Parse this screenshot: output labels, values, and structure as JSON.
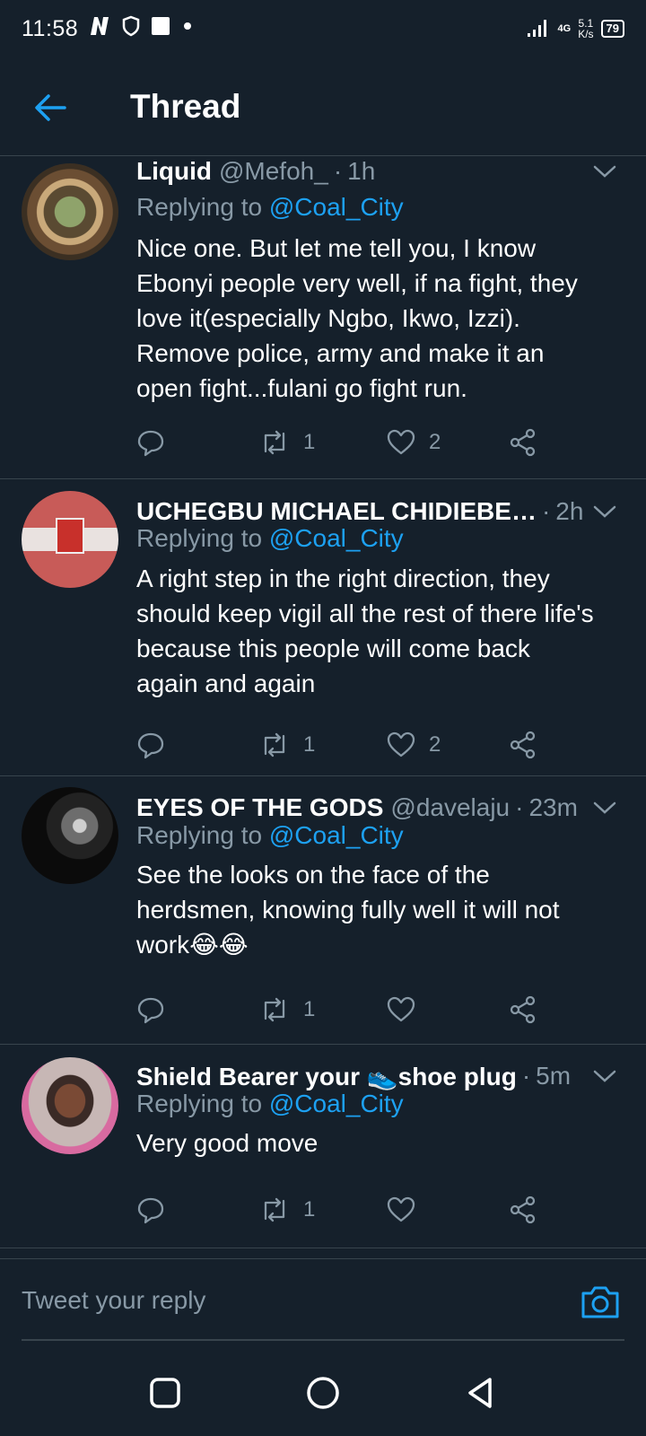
{
  "status_bar": {
    "time": "11:58",
    "network": "4G",
    "speed_value": "5.1",
    "speed_unit": "K/s",
    "battery": "79"
  },
  "header": {
    "title": "Thread",
    "back_icon": "arrow-left-icon"
  },
  "tweets": [
    {
      "name": "Liquid",
      "handle": "@Mefoh_",
      "time": "1h",
      "replying_prefix": "Replying to",
      "replying_to": "@Coal_City",
      "text_lines": [
        "Nice one. But let me tell you, I know",
        "Ebonyi people very well, if na fight, they",
        "love it(especially Ngbo, Ikwo, Izzi).",
        "Remove police, army and make it an",
        "open fight...fulani go fight run."
      ],
      "retweets": "1",
      "likes": "2"
    },
    {
      "name": "UCHEGBU MICHAEL CHIDIEBE…",
      "handle": "",
      "time": "2h",
      "replying_prefix": "Replying to",
      "replying_to": "@Coal_City",
      "text_lines": [
        "A right step in the right direction, they",
        "should keep vigil all the rest of there life's",
        "because this people will come back",
        "again and again"
      ],
      "retweets": "1",
      "likes": "2"
    },
    {
      "name": "EYES OF THE GODS",
      "handle": "@davelaju",
      "time": "23m",
      "replying_prefix": "Replying to",
      "replying_to": "@Coal_City",
      "text_lines": [
        "See the looks on the face of the",
        "herdsmen, knowing fully well it will not",
        "work😂😂"
      ],
      "retweets": "1",
      "likes": ""
    },
    {
      "name": "Shield Bearer your 👟shoe plug",
      "handle": "",
      "time": "5m",
      "replying_prefix": "Replying to",
      "replying_to": "@Coal_City",
      "text_lines": [
        "Very good move"
      ],
      "retweets": "1",
      "likes": ""
    }
  ],
  "reply_bar": {
    "placeholder": "Tweet your reply",
    "camera_icon": "camera-icon"
  },
  "colors": {
    "background": "#15202b",
    "accent": "#1da1f2",
    "secondary_text": "#8899a6",
    "divider": "#38444d"
  }
}
